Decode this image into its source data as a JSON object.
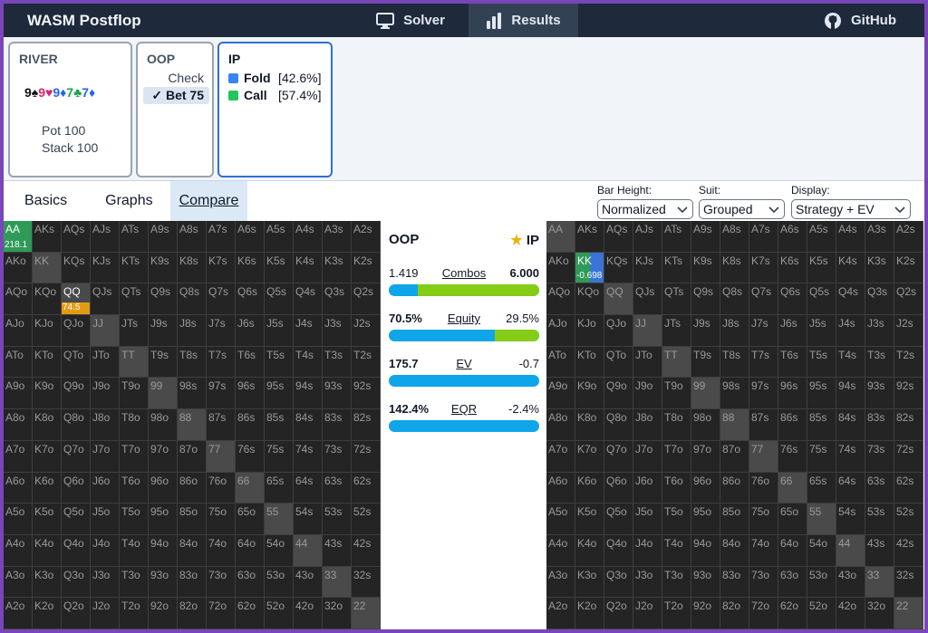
{
  "app": {
    "title": "WASM Postflop"
  },
  "nav": {
    "solver": "Solver",
    "results": "Results",
    "github": "GitHub"
  },
  "river": {
    "header": "RIVER",
    "pot": "Pot 100",
    "stack": "Stack 100",
    "board": [
      {
        "rank": "9",
        "suit": "♠",
        "color": "#111111"
      },
      {
        "rank": "9",
        "suit": "♥",
        "color": "#d9266b"
      },
      {
        "rank": "9",
        "suit": "♦",
        "color": "#2563eb"
      },
      {
        "rank": "7",
        "suit": "♣",
        "color": "#16a34a"
      },
      {
        "rank": "7",
        "suit": "♦",
        "color": "#2563eb"
      }
    ]
  },
  "oop": {
    "header": "OOP",
    "check": "Check",
    "bet": "Bet 75",
    "check_mark": "✓"
  },
  "ip": {
    "header": "IP",
    "fold_label": "Fold",
    "fold_pct": "[42.6%]",
    "call_label": "Call",
    "call_pct": "[57.4%]",
    "fold_color": "#3b82f6",
    "call_color": "#22c55e"
  },
  "tabs": {
    "basics": "Basics",
    "graphs": "Graphs",
    "compare": "Compare"
  },
  "selects": {
    "bar_height": {
      "label": "Bar Height:",
      "value": "Normalized"
    },
    "suit": {
      "label": "Suit:",
      "value": "Grouped"
    },
    "display": {
      "label": "Display:",
      "value": "Strategy + EV"
    }
  },
  "compare": {
    "oop_label": "OOP",
    "ip_label": "IP",
    "star": "★",
    "combos": {
      "label": "Combos",
      "oop": "1.419",
      "ip": "6.000",
      "oop_frac": 0.19
    },
    "equity": {
      "label": "Equity",
      "oop": "70.5%",
      "ip": "29.5%",
      "oop_frac": 0.705
    },
    "ev": {
      "label": "EV",
      "oop": "175.7",
      "ip": "-0.7",
      "oop_frac": 1.0
    },
    "eqr": {
      "label": "EQR",
      "oop": "142.4%",
      "ip": "-2.4%",
      "oop_frac": 1.0
    }
  },
  "ranks": [
    "A",
    "K",
    "Q",
    "J",
    "T",
    "9",
    "8",
    "7",
    "6",
    "5",
    "4",
    "3",
    "2"
  ],
  "oop_highlights": [
    {
      "hand": "AA",
      "ev": "218.1",
      "strategy": "bet",
      "fraction": 1.0
    },
    {
      "hand": "QQ",
      "ev": "74.5",
      "strategy": "check",
      "fraction": 1.0
    }
  ],
  "ip_highlights": [
    {
      "hand": "KK",
      "ev": "-0.698",
      "call_fraction": 0.5,
      "fold_fraction": 0.5
    }
  ],
  "colors": {
    "brand_purple": "#7a45b8",
    "topbar": "#1e293b",
    "bet": "#2f9a58",
    "check": "#e39a13",
    "fold": "#3a74d6"
  }
}
